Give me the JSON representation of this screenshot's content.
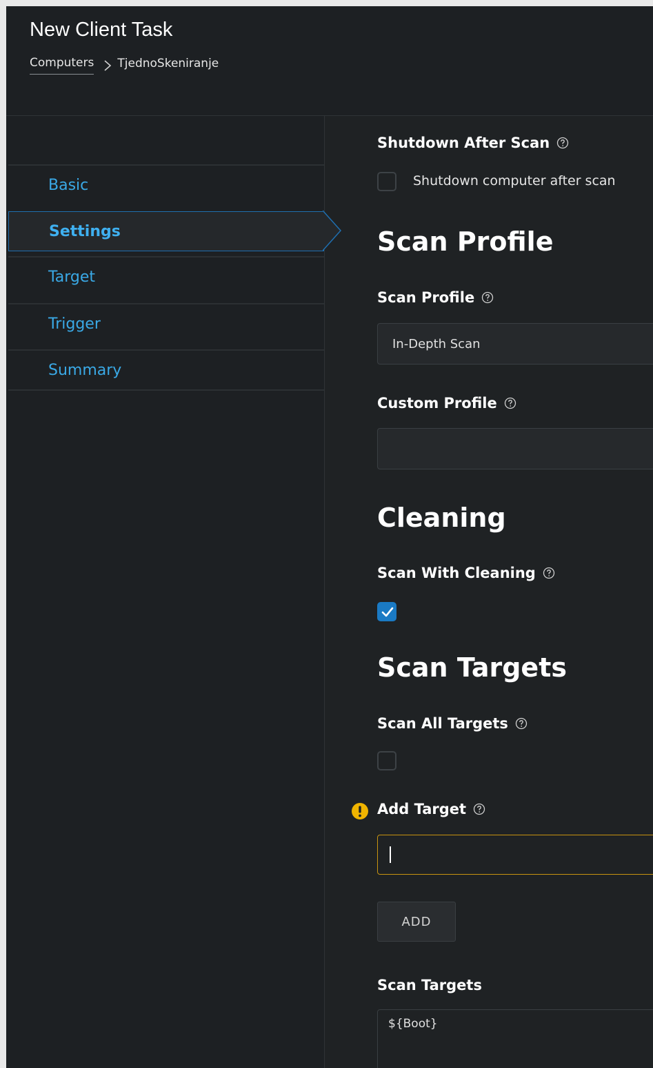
{
  "header": {
    "title": "New Client Task",
    "breadcrumb": {
      "parent": "Computers",
      "current": "TjednoSkeniranje"
    }
  },
  "sidebar": {
    "items": [
      {
        "label": "Basic",
        "active": false
      },
      {
        "label": "Settings",
        "active": true
      },
      {
        "label": "Target",
        "active": false
      },
      {
        "label": "Trigger",
        "active": false
      },
      {
        "label": "Summary",
        "active": false
      }
    ]
  },
  "settings": {
    "shutdown_after_scan": {
      "label": "Shutdown After Scan",
      "checkbox_label": "Shutdown computer after scan",
      "checked": false
    },
    "scan_profile_section": {
      "heading": "Scan Profile"
    },
    "scan_profile": {
      "label": "Scan Profile",
      "value": "In-Depth Scan"
    },
    "custom_profile": {
      "label": "Custom Profile",
      "value": ""
    },
    "cleaning_section": {
      "heading": "Cleaning"
    },
    "scan_with_cleaning": {
      "label": "Scan With Cleaning",
      "checked": true
    },
    "scan_targets_section": {
      "heading": "Scan Targets"
    },
    "scan_all_targets": {
      "label": "Scan All Targets",
      "checked": false
    },
    "add_target": {
      "label": "Add Target",
      "value": "",
      "button_label": "ADD"
    },
    "scan_targets": {
      "label": "Scan Targets",
      "value": "${Boot}"
    }
  },
  "colors": {
    "accent": "#3aa9e6",
    "warning": "#f0b400",
    "checkbox_checked": "#1a7ac4",
    "background": "#1f2224"
  },
  "icons": {
    "help": "help-circle-icon",
    "warning": "warning-icon",
    "breadcrumb_separator": "chevron-right-icon",
    "check": "checkmark-icon"
  }
}
